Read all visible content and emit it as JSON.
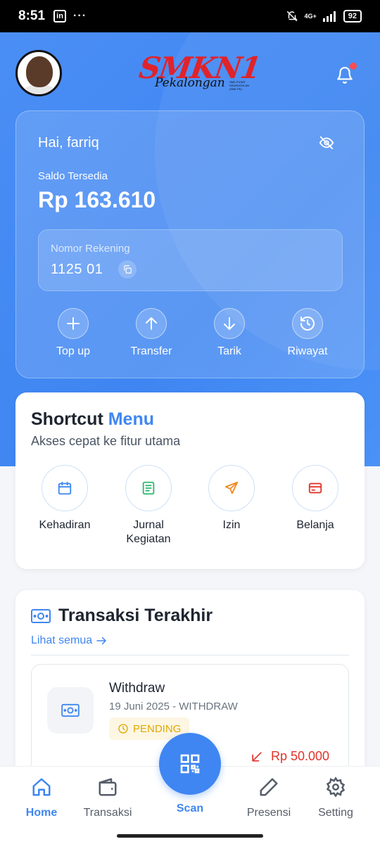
{
  "status_bar": {
    "time": "8:51",
    "linkedin_glyph": "in",
    "dots": "···",
    "network": "4G+",
    "battery": "92"
  },
  "header": {
    "logo_main": "SMKN1",
    "logo_sub": "Pekalongan",
    "logo_tiny": "SMK PUSAT KEUNGGULAN (SMK PK)"
  },
  "balance": {
    "greeting": "Hai, farriq",
    "saldo_label": "Saldo Tersedia",
    "saldo_value": "Rp 163.610",
    "rekening_label": "Nomor Rekening",
    "rekening_value": "1125 01",
    "actions": [
      {
        "label": "Top up",
        "icon": "plus-icon"
      },
      {
        "label": "Transfer",
        "icon": "arrow-up-icon"
      },
      {
        "label": "Tarik",
        "icon": "arrow-down-icon"
      },
      {
        "label": "Riwayat",
        "icon": "history-icon"
      }
    ]
  },
  "shortcut": {
    "title": "Shortcut",
    "title_accent": "Menu",
    "subtitle": "Akses cepat ke fitur utama",
    "items": [
      {
        "label": "Kehadiran",
        "icon": "calendar-icon",
        "color": "#3f86f2"
      },
      {
        "label": "Jurnal Kegiatan",
        "icon": "journal-icon",
        "color": "#2eb872"
      },
      {
        "label": "Izin",
        "icon": "send-icon",
        "color": "#f08a24"
      },
      {
        "label": "Belanja",
        "icon": "card-icon",
        "color": "#e0342b"
      }
    ]
  },
  "transactions": {
    "title": "Transaksi Terakhir",
    "see_all": "Lihat semua",
    "items": [
      {
        "name": "Withdraw",
        "meta": "19 Juni 2025 - WITHDRAW",
        "status": "PENDING",
        "amount": "Rp 50.000"
      }
    ]
  },
  "nav": {
    "items": [
      {
        "label": "Home",
        "icon": "home-icon",
        "active": true
      },
      {
        "label": "Transaksi",
        "icon": "wallet-icon",
        "active": false
      },
      {
        "label": "Presensi",
        "icon": "pencil-icon",
        "active": false
      },
      {
        "label": "Setting",
        "icon": "gear-icon",
        "active": false
      }
    ],
    "scan_label": "Scan"
  },
  "colors": {
    "primary": "#3f86f2",
    "danger": "#e0342b",
    "pending": "#e0a800"
  }
}
